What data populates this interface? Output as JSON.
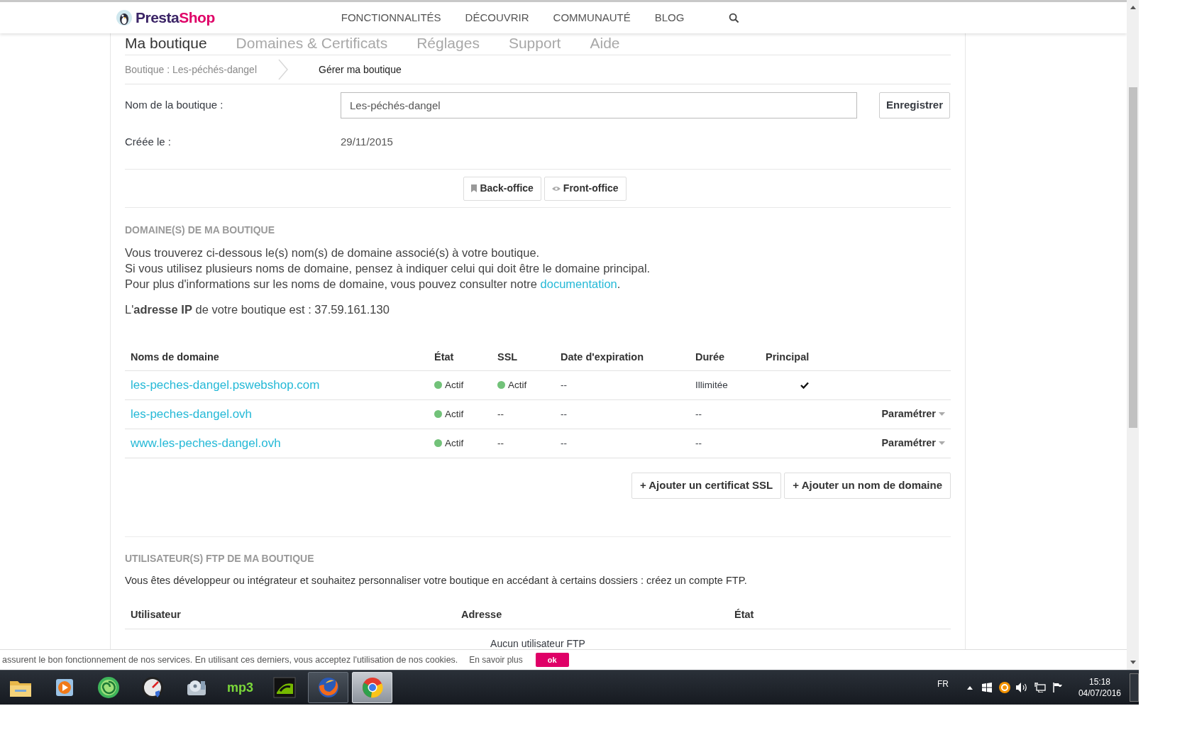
{
  "nav": {
    "logo_first": "Presta",
    "logo_second": "Shop",
    "links": [
      "FONCTIONNALITÉS",
      "DÉCOUVRIR",
      "COMMUNAUTÉ",
      "BLOG"
    ]
  },
  "tabs": [
    {
      "label": "Ma boutique",
      "selected": true
    },
    {
      "label": "Domaines & Certificats",
      "selected": false
    },
    {
      "label": "Réglages",
      "selected": false
    },
    {
      "label": "Support",
      "selected": false
    },
    {
      "label": "Aide",
      "selected": false
    }
  ],
  "breadcrumb": [
    "Boutique : Les-péchés-dangel",
    "Gérer ma boutique"
  ],
  "shop_form": {
    "name_label": "Nom de la boutique :",
    "name_value": "Les-péchés-dangel",
    "save_button": "Enregistrer",
    "created_label": "Créée le :",
    "created_value": "29/11/2015"
  },
  "office_buttons": [
    {
      "label": "Back-office",
      "kind": "bookmark"
    },
    {
      "label": "Front-office",
      "kind": "eye"
    }
  ],
  "domains_section": {
    "heading": "DOMAINE(S) DE MA BOUTIQUE",
    "lines": [
      "Vous trouverez ci-dessous le(s) nom(s) de domaine associé(s) à votre boutique.",
      "Si vous utilisez plusieurs noms de domaine, pensez à indiquer celui qui doit être le domaine principal."
    ],
    "doc_line": {
      "text": "Pour plus d'informations sur les noms de domaine, vous pouvez consulter notre ",
      "link": "documentation",
      "after": "."
    },
    "ip_line": "L'**adresse IP** de votre boutique est : 37.59.161.130",
    "columns": [
      "Noms de domaine",
      "État",
      "SSL",
      "Date d'expiration",
      "Durée",
      "Principal"
    ],
    "rows": [
      {
        "domain": "les-peches-dangel.pswebshop.com",
        "state": "Actif",
        "state_active": true,
        "ssl": "Actif",
        "ssl_active": true,
        "expiration": "--",
        "duration": "Illimitée",
        "principal": true
      },
      {
        "domain": "les-peches-dangel.ovh",
        "state": "Actif",
        "state_active": true,
        "ssl": "--",
        "ssl_active": false,
        "expiration": "--",
        "duration": "--",
        "principal": false,
        "action": "Paramétrer"
      },
      {
        "domain": "www.les-peches-dangel.ovh",
        "state": "Actif",
        "state_active": true,
        "ssl": "--",
        "ssl_active": false,
        "expiration": "--",
        "duration": "--",
        "principal": false,
        "action": "Paramétrer"
      }
    ],
    "add_buttons": [
      "+ Ajouter un certificat SSL",
      "+ Ajouter un nom de domaine"
    ]
  },
  "ftp_section": {
    "heading": "UTILISATEUR(S) FTP DE MA BOUTIQUE",
    "text": "Vous êtes développeur ou intégrateur et souhaitez personnaliser votre boutique en accédant à certains dossiers : créez un compte FTP.",
    "columns": [
      "Utilisateur",
      "Adresse",
      "État"
    ],
    "empty": "Aucun utilisateur FTP"
  },
  "cookie_bar": {
    "text": "assurent le bon fonctionnement de nos services. En utilisant ces derniers, vous acceptez l'utilisation de nos cookies.",
    "link": "En savoir plus",
    "button": "ok"
  },
  "taskbar": {
    "apps": [
      {
        "kind": "folder",
        "selected": false
      },
      {
        "kind": "player",
        "selected": false
      },
      {
        "kind": "swirl",
        "selected": false
      },
      {
        "kind": "gauge",
        "selected": false
      },
      {
        "kind": "drive",
        "selected": false
      },
      {
        "kind": "mp3",
        "label": "mp3",
        "selected": false
      },
      {
        "kind": "nvidia",
        "selected": false
      },
      {
        "kind": "firefox",
        "selected": false,
        "open": true
      },
      {
        "kind": "chrome",
        "selected": true,
        "open": true
      }
    ],
    "language": "FR",
    "time": "15:18",
    "date": "04/07/2016"
  }
}
